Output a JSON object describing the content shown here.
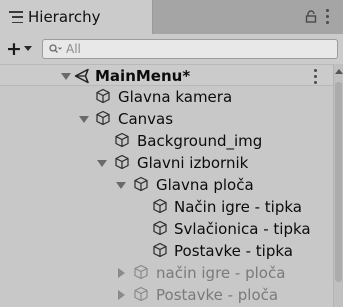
{
  "tab": {
    "title": "Hierarchy",
    "icon": "hierarchy-icon"
  },
  "toolbar": {
    "add_label": "+",
    "search_placeholder": "All"
  },
  "tree": {
    "scene": {
      "label": "MainMenu*",
      "icon": "unity-scene-icon",
      "expanded": true
    },
    "items": [
      {
        "label": "Glavna kamera",
        "icon": "gameobject-cube-icon",
        "depth": 1,
        "has_children": false,
        "expanded": false,
        "active": true
      },
      {
        "label": "Canvas",
        "icon": "gameobject-cube-icon",
        "depth": 1,
        "has_children": true,
        "expanded": true,
        "active": true
      },
      {
        "label": "Background_img",
        "icon": "gameobject-cube-icon",
        "depth": 2,
        "has_children": false,
        "expanded": false,
        "active": true
      },
      {
        "label": "Glavni izbornik",
        "icon": "gameobject-cube-icon",
        "depth": 2,
        "has_children": true,
        "expanded": true,
        "active": true
      },
      {
        "label": "Glavna ploča",
        "icon": "gameobject-cube-icon",
        "depth": 3,
        "has_children": true,
        "expanded": true,
        "active": true
      },
      {
        "label": "Način igre - tipka",
        "icon": "gameobject-cube-icon",
        "depth": 4,
        "has_children": false,
        "expanded": false,
        "active": true
      },
      {
        "label": "Svlačionica - tipka",
        "icon": "gameobject-cube-icon",
        "depth": 4,
        "has_children": false,
        "expanded": false,
        "active": true
      },
      {
        "label": "Postavke - tipka",
        "icon": "gameobject-cube-icon",
        "depth": 4,
        "has_children": false,
        "expanded": false,
        "active": true
      },
      {
        "label": "način igre - ploča",
        "icon": "gameobject-cube-icon",
        "depth": 3,
        "has_children": true,
        "expanded": false,
        "active": false
      },
      {
        "label": "Postavke - ploča",
        "icon": "gameobject-cube-icon",
        "depth": 3,
        "has_children": true,
        "expanded": false,
        "active": false
      }
    ]
  },
  "colors": {
    "panel": "#c8c8c8",
    "tab_active": "#cbcbcb",
    "tab_bar": "#a5a5a5",
    "text": "#0c0c0c",
    "inactive_text": "#7a7a7a"
  }
}
